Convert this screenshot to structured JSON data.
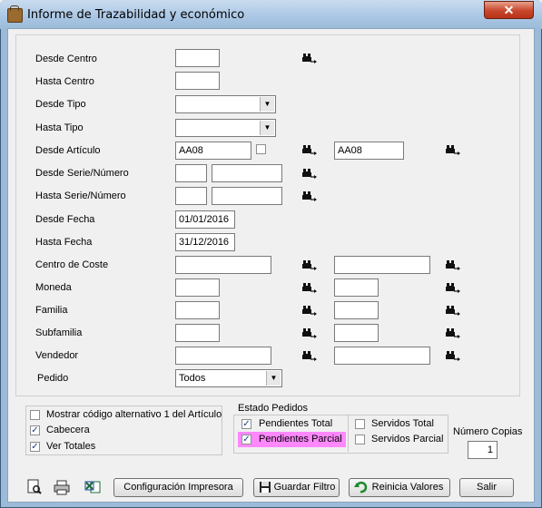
{
  "window": {
    "title": "Informe de Trazabilidad y económico",
    "close_label": "✕"
  },
  "labels": {
    "desde_centro": "Desde Centro",
    "hasta_centro": "Hasta Centro",
    "desde_tipo": "Desde Tipo",
    "hasta_tipo": "Hasta Tipo",
    "desde_articulo": "Desde Artículo",
    "desde_serie": "Desde Serie/Número",
    "hasta_serie": "Hasta Serie/Número",
    "desde_fecha": "Desde Fecha",
    "hasta_fecha": "Hasta Fecha",
    "centro_coste": "Centro de Coste",
    "moneda": "Moneda",
    "familia": "Familia",
    "subfamilia": "Subfamilia",
    "vendedor": "Vendedor",
    "pedido": "Pedido"
  },
  "values": {
    "desde_articulo": "AA08",
    "hasta_articulo": "AA08",
    "desde_fecha": "01/01/2016",
    "hasta_fecha": "31/12/2016",
    "pedido": "Todos"
  },
  "options": {
    "mostrar_codigo": "Mostrar código alternativo 1 del Artículo",
    "cabecera": "Cabecera",
    "ver_totales": "Ver Totales"
  },
  "estado": {
    "title": "Estado Pedidos",
    "pendientes_total": "Pendientes Total",
    "pendientes_parcial": "Pendientes Parcial",
    "servidos_total": "Servidos Total",
    "servidos_parcial": "Servidos Parcial"
  },
  "copias": {
    "label": "Número Copias",
    "value": "1"
  },
  "buttons": {
    "config": "Configuración Impresora",
    "guardar": "Guardar Filtro",
    "reiniciar": "Reinicia Valores",
    "salir": "Salir"
  },
  "colors": {
    "highlight": "#ff88ff",
    "titlebar": "#a9c6e4",
    "close": "#c8452b"
  },
  "icons": [
    "binoculars-icon",
    "print-preview-icon",
    "printer-icon",
    "excel-icon",
    "disk-icon",
    "undo-icon"
  ]
}
